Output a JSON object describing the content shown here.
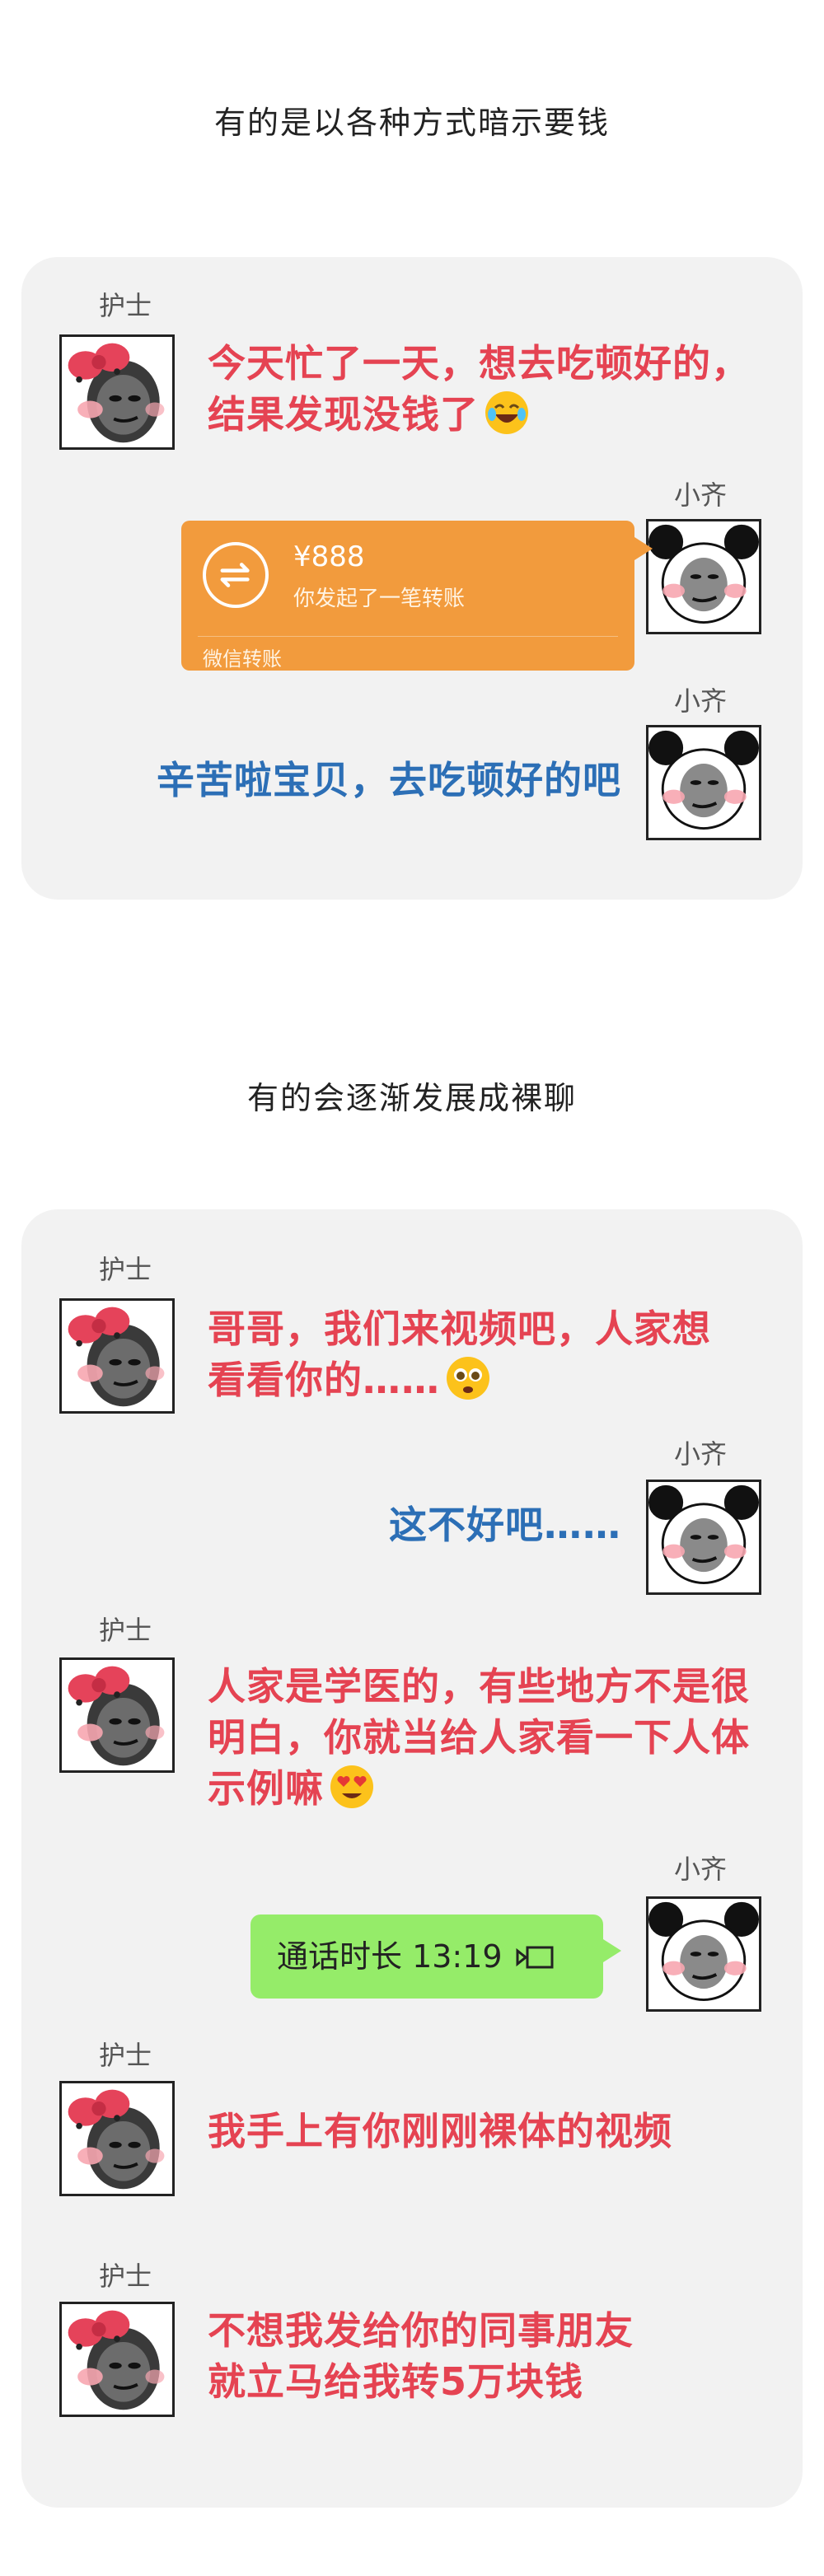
{
  "section1": {
    "title": "有的是以各种方式暗示要钱",
    "nurse_name": "护士",
    "nurse_msg_line1": "今天忙了一天，想去吃顿好的，",
    "nurse_msg_line2": "结果发现没钱了",
    "xiaoqi_name_1": "小齐",
    "transfer": {
      "amount": "¥888",
      "desc": "你发起了一笔转账",
      "footer": "微信转账"
    },
    "xiaoqi_name_2": "小齐",
    "xiaoqi_msg": "辛苦啦宝贝，去吃顿好的吧"
  },
  "section2": {
    "title": "有的会逐渐发展成裸聊",
    "nurse_name_1": "护士",
    "nurse_msg_1_line1": "哥哥，我们来视频吧，人家想",
    "nurse_msg_1_line2": "看看你的……",
    "xiaoqi_name_1": "小齐",
    "xiaoqi_msg_1": "这不好吧……",
    "nurse_name_2": "护士",
    "nurse_msg_2_line1": "人家是学医的，有些地方不是很",
    "nurse_msg_2_line2": "明白，你就当给人家看一下人体",
    "nurse_msg_2_line3": "示例嘛",
    "xiaoqi_name_2": "小齐",
    "call_text": "通话时长 13:19",
    "nurse_name_3": "护士",
    "nurse_msg_3": "我手上有你刚刚裸体的视频",
    "nurse_name_4": "护士",
    "nurse_msg_4_line1": "不想我发给你的同事朋友",
    "nurse_msg_4_line2": "就立马给我转5万块钱"
  },
  "colors": {
    "nurse_text": "#e54352",
    "xiaoqi_text": "#2c6fb6",
    "transfer_bg": "#f29b3d",
    "call_bg": "#95ec69",
    "panel_bg": "#f2f2f2"
  },
  "icons": [
    "nurse-avatar-icon",
    "panda-avatar-icon",
    "laughing-emoji-icon",
    "pleading-emoji-icon",
    "heart-eyes-emoji-icon",
    "transfer-icon",
    "video-camera-icon"
  ]
}
